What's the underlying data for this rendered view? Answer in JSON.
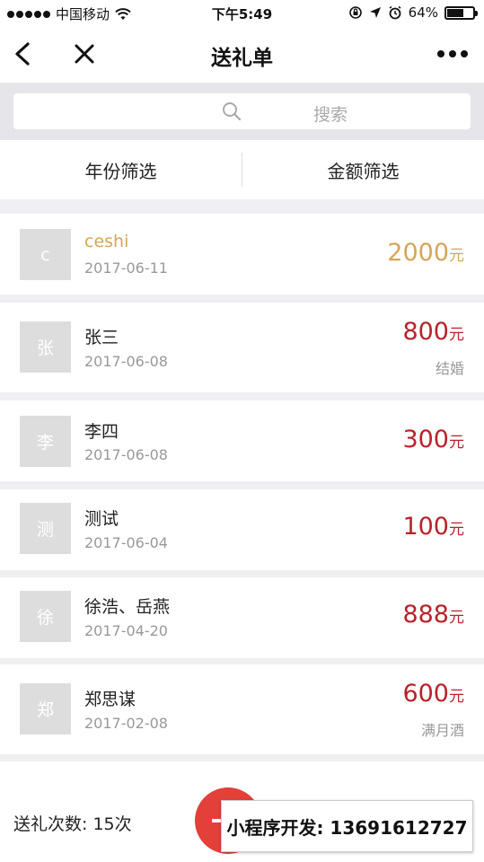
{
  "status_bar": {
    "carrier": "中国移动",
    "time": "下午5:49",
    "battery_percent": "64%",
    "battery_level": 0.64,
    "icons": [
      "signal-icon",
      "wifi-icon",
      "orientation-lock-icon",
      "location-arrow-icon",
      "alarm-icon",
      "battery-icon"
    ]
  },
  "nav": {
    "title": "送礼单",
    "back_icon": "chevron-left-icon",
    "close_icon": "close-icon",
    "more_icon": "more-dots-icon"
  },
  "search": {
    "placeholder": "搜索",
    "icon": "search-icon"
  },
  "filters": [
    {
      "label": "年份筛选"
    },
    {
      "label": "金额筛选"
    }
  ],
  "records": [
    {
      "avatar": "c",
      "name": "ceshi",
      "date": "2017-06-11",
      "amount": "2000",
      "unit": "元",
      "note": ""
    },
    {
      "avatar": "张",
      "name": "张三",
      "date": "2017-06-08",
      "amount": "800",
      "unit": "元",
      "note": "结婚"
    },
    {
      "avatar": "李",
      "name": "李四",
      "date": "2017-06-08",
      "amount": "300",
      "unit": "元",
      "note": ""
    },
    {
      "avatar": "测",
      "name": "测试",
      "date": "2017-06-04",
      "amount": "100",
      "unit": "元",
      "note": ""
    },
    {
      "avatar": "徐",
      "name": "徐浩、岳燕",
      "date": "2017-04-20",
      "amount": "888",
      "unit": "元",
      "note": ""
    },
    {
      "avatar": "郑",
      "name": "郑思谋",
      "date": "2017-02-08",
      "amount": "600",
      "unit": "元",
      "note": "满月酒"
    }
  ],
  "footer": {
    "count_label": "送礼次数: 15次",
    "add_icon": "plus-icon",
    "watermark": "小程序开发: 13691612727"
  },
  "colors": {
    "amount": "#b8232a",
    "highlight": "#d4a65a",
    "fab": "#e3403a"
  }
}
